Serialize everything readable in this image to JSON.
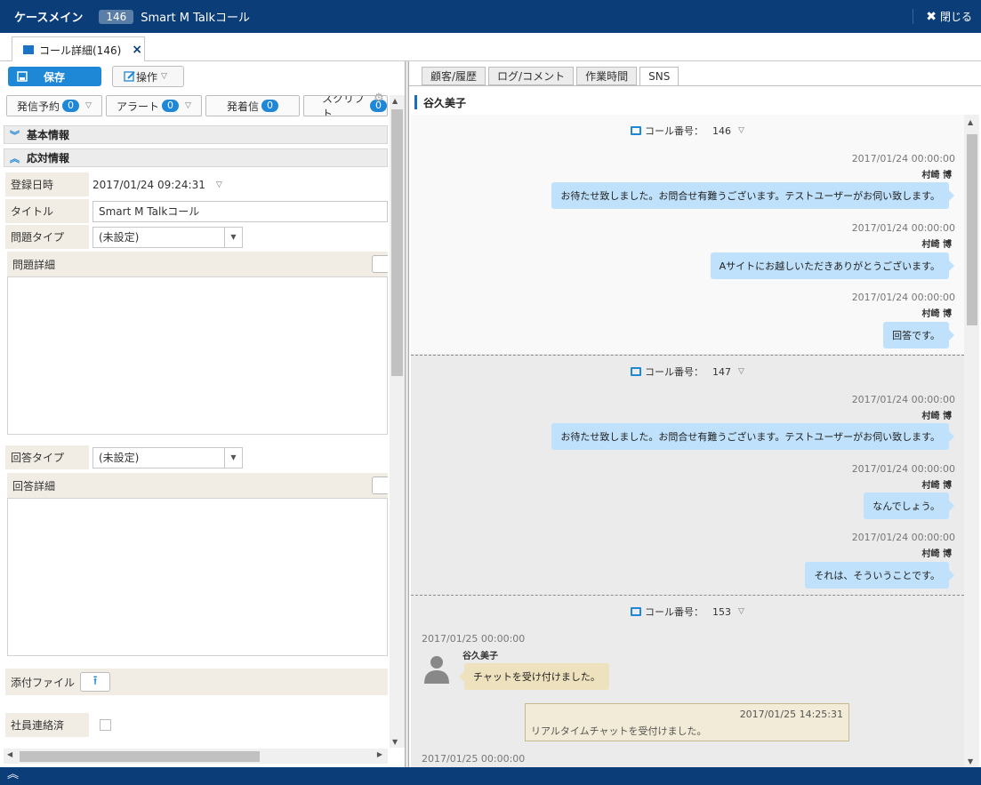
{
  "window": {
    "title": "ケースメイン",
    "case_number": "146",
    "case_name": "Smart M Talkコール",
    "close_label": "閉じる"
  },
  "doc_tab": {
    "label": "コール詳細(146)"
  },
  "toolbar": {
    "save_label": "保存",
    "operation_label": "操作"
  },
  "counters": [
    {
      "label": "発信予約",
      "count": "0"
    },
    {
      "label": "アラート",
      "count": "0"
    },
    {
      "label": "発着信",
      "count": "0"
    },
    {
      "label": "スクリプト",
      "count": "0"
    }
  ],
  "sections": {
    "basic_info": "基本情報",
    "response_info": "応対情報"
  },
  "form": {
    "registered_label": "登録日時",
    "registered_value": "2017/01/24 09:24:31",
    "title_label": "タイトル",
    "title_value": "Smart M Talkコール",
    "problem_type_label": "問題タイプ",
    "problem_type_value": "(未設定)",
    "problem_detail_label": "問題詳細",
    "answer_type_label": "回答タイプ",
    "answer_type_value": "(未設定)",
    "answer_detail_label": "回答詳細",
    "attachment_label": "添付ファイル",
    "staff_contacted_label": "社員連絡済"
  },
  "right_tabs": [
    "顧客/履歴",
    "ログ/コメント",
    "作業時間",
    "SNS"
  ],
  "customer_name": "谷久美子",
  "chat": {
    "call_label": "コール番号：",
    "calls": [
      {
        "number": "146",
        "messages": [
          {
            "time": "2017/01/24 00:00:00",
            "author": "村崎 博",
            "text": "お待たせ致しました。お問合せ有難うございます。テストユーザーがお伺い致します。"
          },
          {
            "time": "2017/01/24 00:00:00",
            "author": "村崎 博",
            "text": "Aサイトにお越しいただきありがとうございます。"
          },
          {
            "time": "2017/01/24 00:00:00",
            "author": "村崎 博",
            "text": "回答です。"
          }
        ]
      },
      {
        "number": "147",
        "messages": [
          {
            "time": "2017/01/24 00:00:00",
            "author": "村崎 博",
            "text": "お待たせ致しました。お問合せ有難うございます。テストユーザーがお伺い致します。"
          },
          {
            "time": "2017/01/24 00:00:00",
            "author": "村崎 博",
            "text": "なんでしょう。"
          },
          {
            "time": "2017/01/24 00:00:00",
            "author": "村崎 博",
            "text": "それは、そういうことです。"
          }
        ]
      },
      {
        "number": "153",
        "customer_time": "2017/01/25 00:00:00",
        "customer_author": "谷久美子",
        "customer_text": "チャットを受け付けました。",
        "system_time": "2017/01/25 14:25:31",
        "system_text": "リアルタイムチャットを受付けました。",
        "next_time": "2017/01/25 00:00:00"
      }
    ]
  },
  "colors": {
    "header_bg": "#0b3d78",
    "accent": "#1e87d6",
    "agent_bubble": "#bfe1fb",
    "customer_bubble": "#eee1bd"
  }
}
